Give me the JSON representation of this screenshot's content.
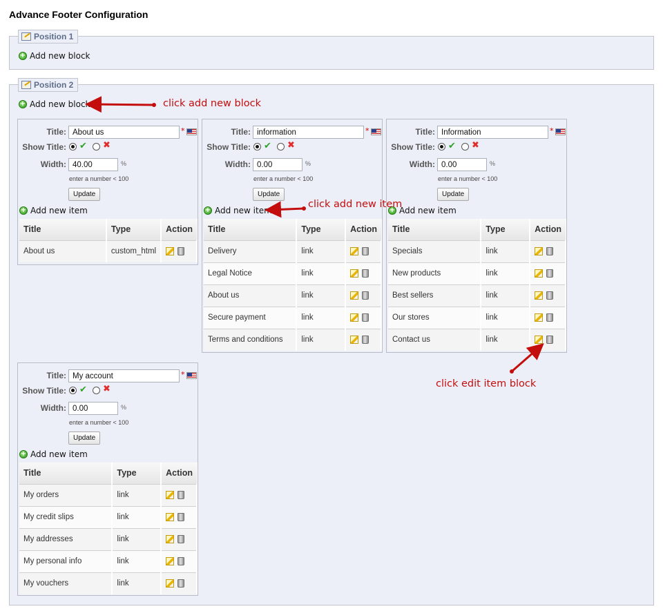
{
  "page": {
    "title": "Advance Footer Configuration"
  },
  "positions": [
    {
      "legend": "Position 1",
      "add_block_label": "Add new block"
    },
    {
      "legend": "Position 2",
      "add_block_label": "Add new block"
    }
  ],
  "blocks": [
    {
      "title_label": "Title:",
      "title_value": "About us",
      "show_title_label": "Show Title:",
      "width_label": "Width:",
      "width_value": "40.00",
      "unit": "%",
      "hint": "enter a number < 100",
      "update_label": "Update",
      "add_item_label": "Add new item",
      "columns": [
        "Title",
        "Type",
        "Action"
      ],
      "items": [
        {
          "title": "About us",
          "type": "custom_html"
        }
      ]
    },
    {
      "title_label": "Title:",
      "title_value": "information",
      "show_title_label": "Show Title:",
      "width_label": "Width:",
      "width_value": "0.00",
      "unit": "%",
      "hint": "enter a number < 100",
      "update_label": "Update",
      "add_item_label": "Add new item",
      "columns": [
        "Title",
        "Type",
        "Action"
      ],
      "items": [
        {
          "title": "Delivery",
          "type": "link"
        },
        {
          "title": "Legal Notice",
          "type": "link"
        },
        {
          "title": "About us",
          "type": "link"
        },
        {
          "title": "Secure payment",
          "type": "link"
        },
        {
          "title": "Terms and conditions",
          "type": "link"
        }
      ]
    },
    {
      "title_label": "Title:",
      "title_value": "Information",
      "show_title_label": "Show Title:",
      "width_label": "Width:",
      "width_value": "0.00",
      "unit": "%",
      "hint": "enter a number < 100",
      "update_label": "Update",
      "add_item_label": "Add new item",
      "columns": [
        "Title",
        "Type",
        "Action"
      ],
      "items": [
        {
          "title": "Specials",
          "type": "link"
        },
        {
          "title": "New products",
          "type": "link"
        },
        {
          "title": "Best sellers",
          "type": "link"
        },
        {
          "title": "Our stores",
          "type": "link"
        },
        {
          "title": "Contact us",
          "type": "link"
        }
      ]
    },
    {
      "title_label": "Title:",
      "title_value": "My account",
      "show_title_label": "Show Title:",
      "width_label": "Width:",
      "width_value": "0.00",
      "unit": "%",
      "hint": "enter a number < 100",
      "update_label": "Update",
      "add_item_label": "Add new item",
      "columns": [
        "Title",
        "Type",
        "Action"
      ],
      "items": [
        {
          "title": "My orders",
          "type": "link"
        },
        {
          "title": "My credit slips",
          "type": "link"
        },
        {
          "title": "My addresses",
          "type": "link"
        },
        {
          "title": "My personal info",
          "type": "link"
        },
        {
          "title": "My vouchers",
          "type": "link"
        }
      ]
    }
  ],
  "annotations": {
    "add_block": "click add new block",
    "add_item": "click add new item",
    "edit_item": "click edit item block"
  },
  "colors": {
    "panel_bg": "#eceff7",
    "annotation": "#c40d0d",
    "accept": "#2fa12a",
    "reject": "#e12c2c"
  },
  "icons": [
    "legend-edit-icon",
    "add-circle-icon",
    "flag-us-icon",
    "check-icon",
    "cross-icon",
    "edit-icon",
    "trash-icon"
  ]
}
